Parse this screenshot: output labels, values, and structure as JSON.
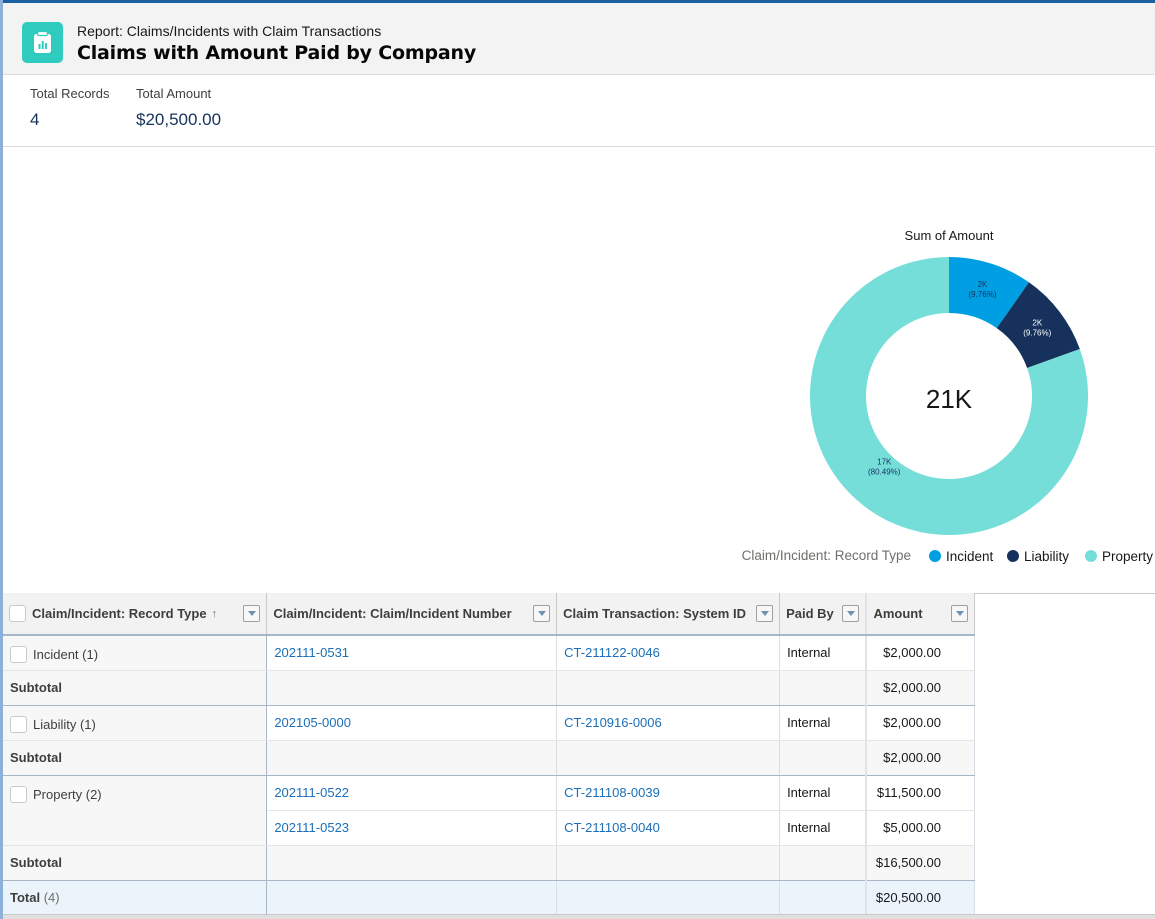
{
  "header": {
    "subtitle": "Report: Claims/Incidents with Claim Transactions",
    "title": "Claims with Amount Paid by Company",
    "icon": "report-icon"
  },
  "summary": [
    {
      "label": "Total Records",
      "value": "4"
    },
    {
      "label": "Total Amount",
      "value": "$20,500.00"
    }
  ],
  "chart_data": {
    "type": "pie",
    "variant": "donut",
    "title": "Sum of Amount",
    "center_label": "21K",
    "legend_title": "Claim/Incident: Record Type",
    "legend_position": "bottom-right",
    "categories": [
      "Incident",
      "Liability",
      "Property"
    ],
    "values": [
      2000,
      2000,
      16500
    ],
    "slice_labels": [
      "2K",
      "2K",
      "17K"
    ],
    "percent_labels": [
      "(9.76%)",
      "(9.76%)",
      "(80.49%)"
    ],
    "colors": [
      "#009fe3",
      "#16325c",
      "#76ded9"
    ]
  },
  "table": {
    "columns": [
      {
        "label": "Claim/Incident: Record Type",
        "sorted": "ascending"
      },
      {
        "label": "Claim/Incident: Claim/Incident Number"
      },
      {
        "label": "Claim Transaction: System ID"
      },
      {
        "label": "Paid By"
      },
      {
        "label": "Amount"
      }
    ],
    "groups": [
      {
        "label": "Incident (1)",
        "rows": [
          {
            "number": "202111-0531",
            "system_id": "CT-211122-0046",
            "paid_by": "Internal",
            "amount": "$2,000.00"
          }
        ],
        "subtotal_label": "Subtotal",
        "subtotal": "$2,000.00"
      },
      {
        "label": "Liability (1)",
        "rows": [
          {
            "number": "202105-0000",
            "system_id": "CT-210916-0006",
            "paid_by": "Internal",
            "amount": "$2,000.00"
          }
        ],
        "subtotal_label": "Subtotal",
        "subtotal": "$2,000.00"
      },
      {
        "label": "Property (2)",
        "rows": [
          {
            "number": "202111-0522",
            "system_id": "CT-211108-0039",
            "paid_by": "Internal",
            "amount": "$11,500.00"
          },
          {
            "number": "202111-0523",
            "system_id": "CT-211108-0040",
            "paid_by": "Internal",
            "amount": "$5,000.00"
          }
        ],
        "subtotal_label": "Subtotal",
        "subtotal": "$16,500.00"
      }
    ],
    "total_label": "Total",
    "total_count": "(4)",
    "total": "$20,500.00"
  }
}
